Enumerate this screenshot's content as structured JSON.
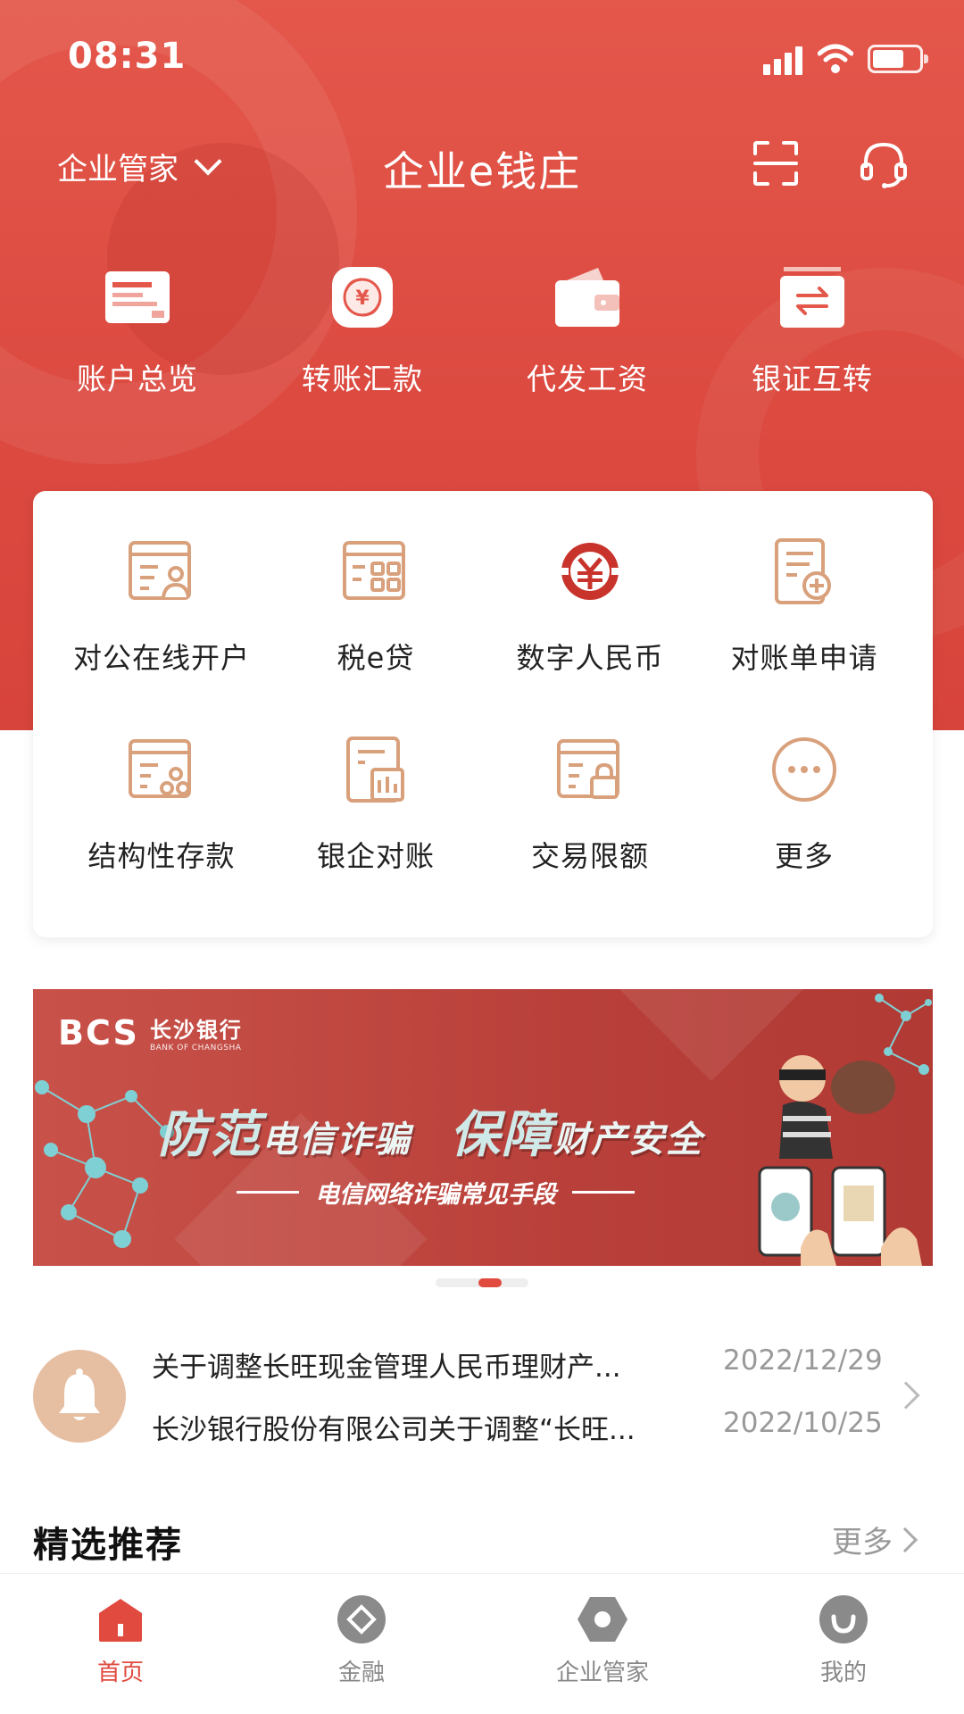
{
  "status_bar": {
    "time": "08:31"
  },
  "header": {
    "org_switch_label": "企业管家",
    "title": "企业e钱庄"
  },
  "top_actions": [
    {
      "label": "账户总览",
      "icon": "card-icon"
    },
    {
      "label": "转账汇款",
      "icon": "transfer-yen-icon"
    },
    {
      "label": "代发工资",
      "icon": "wallet-icon"
    },
    {
      "label": "银证互转",
      "icon": "exchange-icon"
    }
  ],
  "services": [
    {
      "label": "对公在线开户",
      "icon": "account-person-icon"
    },
    {
      "label": "税e贷",
      "icon": "tax-loan-icon"
    },
    {
      "label": "数字人民币",
      "icon": "digital-yuan-icon"
    },
    {
      "label": "对账单申请",
      "icon": "statement-add-icon"
    },
    {
      "label": "结构性存款",
      "icon": "structured-deposit-icon"
    },
    {
      "label": "银企对账",
      "icon": "reconcile-icon"
    },
    {
      "label": "交易限额",
      "icon": "limit-lock-icon"
    },
    {
      "label": "更多",
      "icon": "more-icon"
    }
  ],
  "banner": {
    "logo_mark": "BCS",
    "logo_cn": "长沙银行",
    "logo_en": "BANK OF CHANGSHA",
    "headline_a": "防范",
    "headline_a_small": "电信诈骗",
    "headline_b": "保障",
    "headline_b_small": "财产安全",
    "subtitle": "电信网络诈骗常见手段"
  },
  "notices": [
    {
      "text": "关于调整长旺现金管理人民币理财产...",
      "date": "2022/12/29"
    },
    {
      "text": "长沙银行股份有限公司关于调整“长旺...",
      "date": "2022/10/25"
    }
  ],
  "recommend": {
    "title": "精选推荐",
    "more": "更多"
  },
  "tabs": [
    {
      "label": "首页",
      "icon": "home-icon",
      "active": true
    },
    {
      "label": "金融",
      "icon": "finance-icon",
      "active": false
    },
    {
      "label": "企业管家",
      "icon": "enterprise-icon",
      "active": false
    },
    {
      "label": "我的",
      "icon": "profile-icon",
      "active": false
    }
  ],
  "colors": {
    "brand_red": "#e04a3f",
    "service_icon": "#d9a07c",
    "digital_yuan": "#c8342c"
  }
}
